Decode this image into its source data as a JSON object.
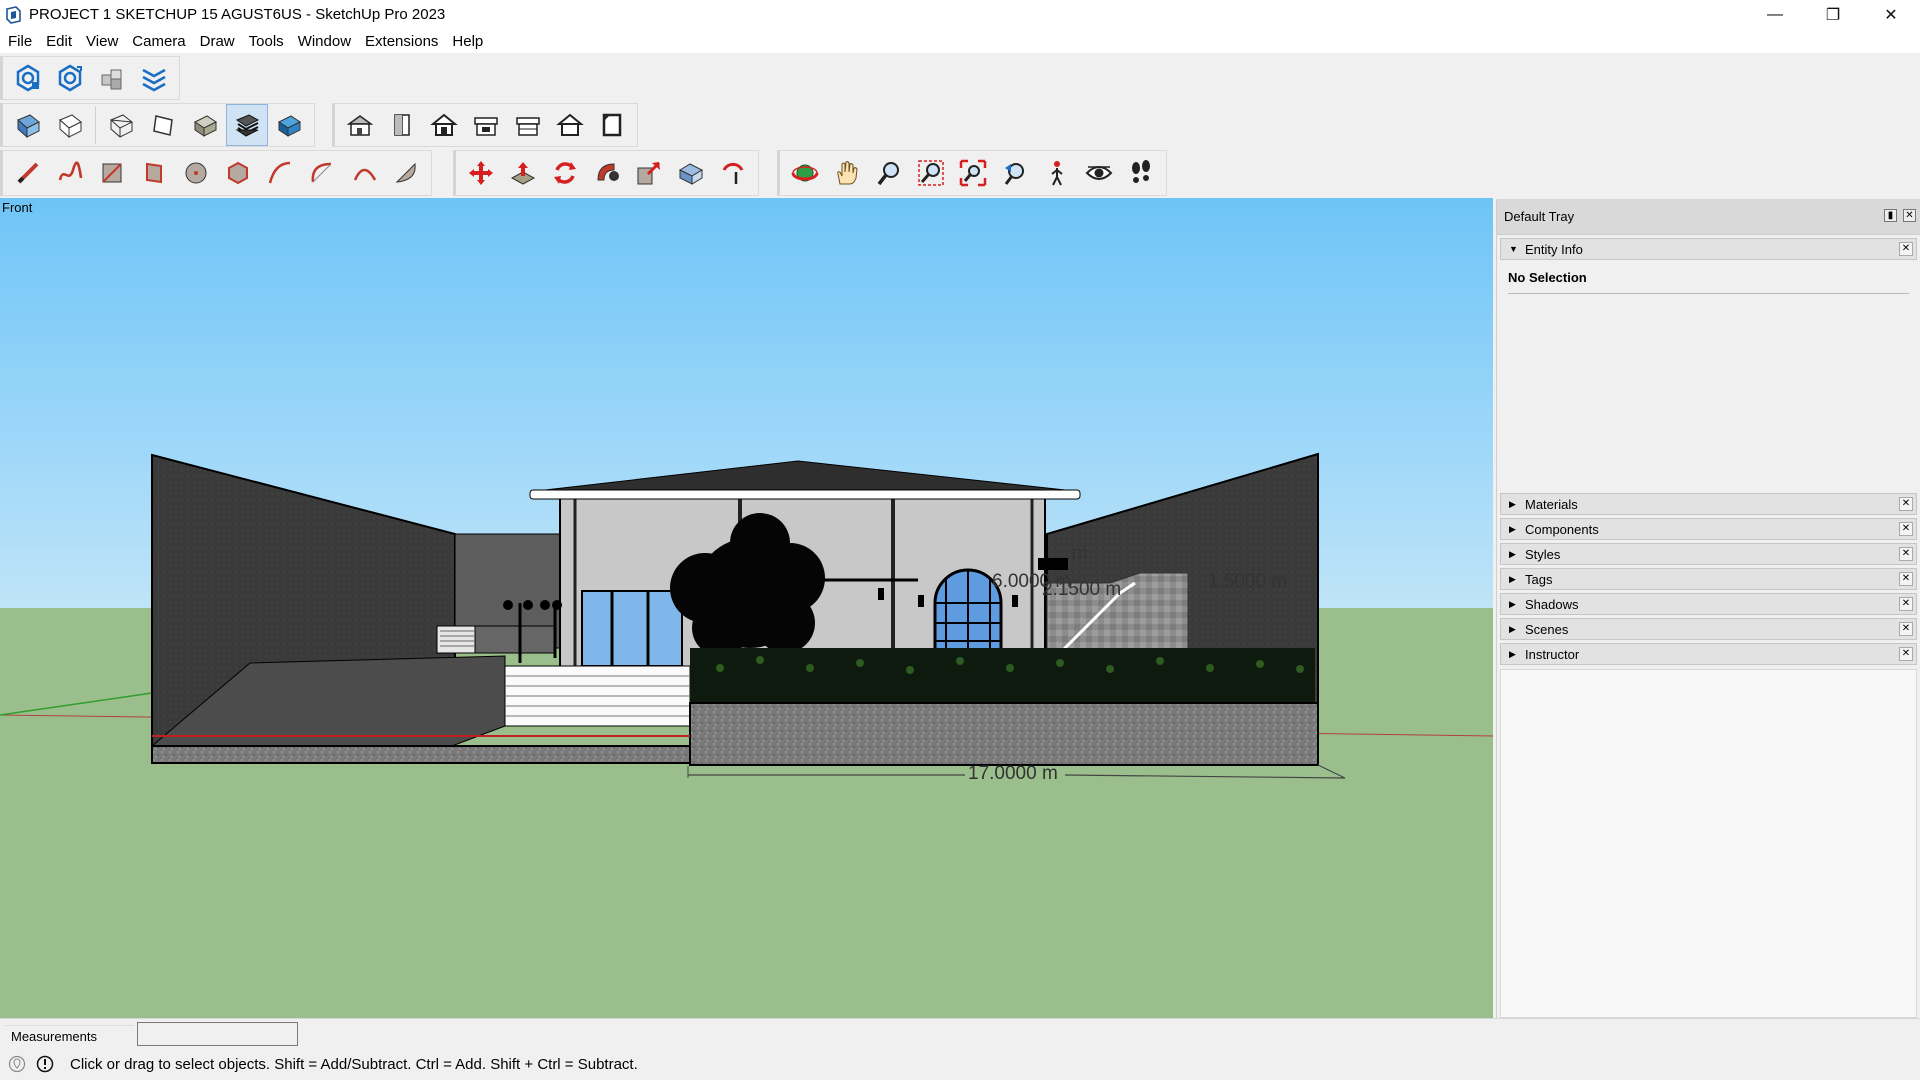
{
  "window": {
    "title": "PROJECT 1 SKETCHUP 15 AGUST6US - SketchUp Pro 2023",
    "minimize": "—",
    "restore": "❐",
    "close": "✕"
  },
  "menu": [
    "File",
    "Edit",
    "View",
    "Camera",
    "Draw",
    "Tools",
    "Window",
    "Extensions",
    "Help"
  ],
  "toolbar": {
    "row1": [
      "extension-warehouse",
      "3d-warehouse",
      "components",
      "layout-send"
    ],
    "row2_styles": [
      "xray",
      "back-edges",
      "wireframe",
      "hidden-line",
      "shaded",
      "shaded-with-textures",
      "monochrome"
    ],
    "row2_views": [
      "iso",
      "top",
      "front",
      "right",
      "back",
      "left"
    ],
    "row3_draw": [
      "pencil",
      "freehand",
      "rectangle",
      "rotated-rectangle",
      "circle",
      "polygon",
      "arc",
      "2-point-arc",
      "3-point-arc",
      "pie"
    ],
    "row3_edit": [
      "move",
      "push-pull",
      "rotate",
      "follow-me",
      "scale",
      "offset",
      "position-camera"
    ],
    "row3_camera": [
      "orbit",
      "pan",
      "zoom",
      "zoom-window",
      "zoom-extents",
      "previous",
      "walk",
      "look-around",
      "footprints"
    ],
    "active_style": "shaded-with-textures"
  },
  "viewport": {
    "view_label": "Front",
    "dimensions": {
      "width_label": "17.0000 m",
      "d1": "6.0000 m",
      "d2": "2.1500 m",
      "d3": "1.5000 m",
      "d4": "m"
    }
  },
  "tray": {
    "title": "Default Tray",
    "entity_info": {
      "label": "Entity Info",
      "value": "No Selection"
    },
    "panels": [
      "Materials",
      "Components",
      "Styles",
      "Tags",
      "Shadows",
      "Scenes",
      "Instructor"
    ]
  },
  "measurements": {
    "label": "Measurements",
    "value": ""
  },
  "status": {
    "text": "Click or drag to select objects. Shift = Add/Subtract. Ctrl = Add. Shift + Ctrl = Subtract."
  }
}
